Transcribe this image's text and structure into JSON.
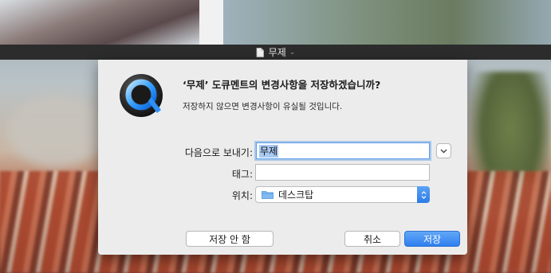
{
  "window": {
    "title": "무제",
    "title_chevron": "⌄"
  },
  "dialog": {
    "headline": "‘무제’ 도큐멘트의 변경사항을 저장하겠습니까?",
    "subtext": "저장하지 않으면 변경사항이 유실될 것입니다.",
    "export_label": "다음으로 보내기:",
    "export_value": "무제",
    "tags_label": "태그:",
    "tags_value": "",
    "location_label": "위치:",
    "location_value": "데스크탑",
    "dont_save_label": "저장 안 함",
    "cancel_label": "취소",
    "save_label": "저장",
    "expand_icon": "chevron-down-icon"
  },
  "colors": {
    "accent": "#2f7ef0",
    "titlebar": "#2c2c2c",
    "sheet": "#ececec"
  }
}
